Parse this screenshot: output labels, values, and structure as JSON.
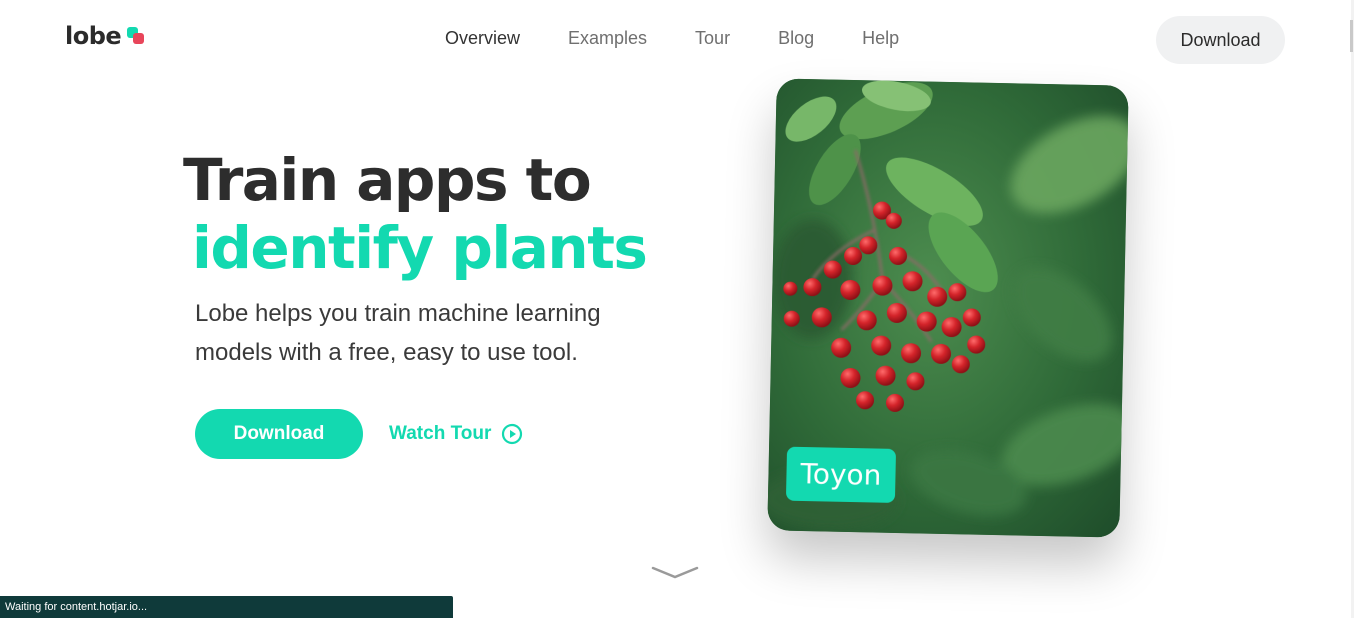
{
  "theme": {
    "accent": "#13d9b0",
    "logo_red": "#e8455a",
    "status_bar_bg": "#0f3a3a"
  },
  "header": {
    "logo_text": "lobe",
    "nav": [
      {
        "label": "Overview"
      },
      {
        "label": "Examples"
      },
      {
        "label": "Tour"
      },
      {
        "label": "Blog"
      },
      {
        "label": "Help"
      }
    ],
    "download_label": "Download"
  },
  "hero": {
    "title_line1": "Train apps to",
    "title_line2": "identify plants",
    "subtitle": "Lobe helps you train machine learning models with a free, easy to use tool.",
    "cta_download": "Download",
    "watch_tour": "Watch Tour"
  },
  "card": {
    "label": "Toyon",
    "image_icon": "toyon-berries-photo"
  },
  "status_bar": {
    "text": "Waiting for content.hotjar.io..."
  }
}
